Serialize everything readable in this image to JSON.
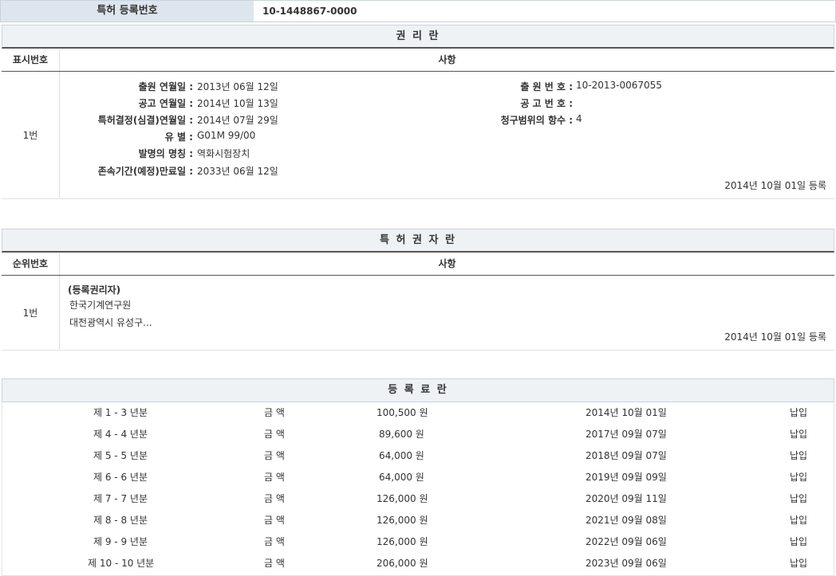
{
  "registration": {
    "label": "특허 등록번호",
    "value": "10-1448867-0000"
  },
  "rights": {
    "title": "권 리 란",
    "col_num": "표시번호",
    "col_item": "사항",
    "row_num": "1번",
    "left": [
      {
        "label": "출원 연월일 :",
        "value": "2013년 06월 12일"
      },
      {
        "label": "공고 연월일 :",
        "value": "2014년 10월 13일"
      },
      {
        "label": "특허결정(심결)연월일 :",
        "value": "2014년 07월 29일"
      },
      {
        "label": "유 별 :",
        "value": "G01M 99/00"
      },
      {
        "label": "발명의 명칭 :",
        "value": "역화시험장치"
      },
      {
        "label": "존속기간(예정)만료일 :",
        "value": "2033년 06월 12일"
      }
    ],
    "right": [
      {
        "label": "출 원 번 호 :",
        "value": "10-2013-0067055"
      },
      {
        "label": "공 고 번 호 :",
        "value": ""
      },
      {
        "label": "청구범위의 항수 :",
        "value": "4"
      }
    ],
    "registered": "2014년 10월 01일 등록"
  },
  "holder": {
    "title": "특 허 권 자 란",
    "col_num": "순위번호",
    "col_item": "사항",
    "row_num": "1번",
    "heading": "(등록권리자)",
    "name": "한국기계연구원",
    "address": "대전광역시 유성구...",
    "registered": "2014년 10월 01일 등록"
  },
  "fees": {
    "title": "등 록 료 란",
    "rows": [
      {
        "period": "제 1 - 3 년분",
        "label": "금 액",
        "amount": "100,500 원",
        "date": "2014년 10월 01일",
        "status": "납입"
      },
      {
        "period": "제 4 - 4 년분",
        "label": "금 액",
        "amount": "89,600 원",
        "date": "2017년 09월 07일",
        "status": "납입"
      },
      {
        "period": "제 5 - 5 년분",
        "label": "금 액",
        "amount": "64,000 원",
        "date": "2018년 09월 07일",
        "status": "납입"
      },
      {
        "period": "제 6 - 6 년분",
        "label": "금 액",
        "amount": "64,000 원",
        "date": "2019년 09월 09일",
        "status": "납입"
      },
      {
        "period": "제 7 - 7 년분",
        "label": "금 액",
        "amount": "126,000 원",
        "date": "2020년 09월 11일",
        "status": "납입"
      },
      {
        "period": "제 8 - 8 년분",
        "label": "금 액",
        "amount": "126,000 원",
        "date": "2021년 09월 08일",
        "status": "납입"
      },
      {
        "period": "제 9 - 9 년분",
        "label": "금 액",
        "amount": "126,000 원",
        "date": "2022년 09월 06일",
        "status": "납입"
      },
      {
        "period": "제 10 - 10 년분",
        "label": "금 액",
        "amount": "206,000 원",
        "date": "2023년 09월 06일",
        "status": "납입"
      }
    ]
  }
}
